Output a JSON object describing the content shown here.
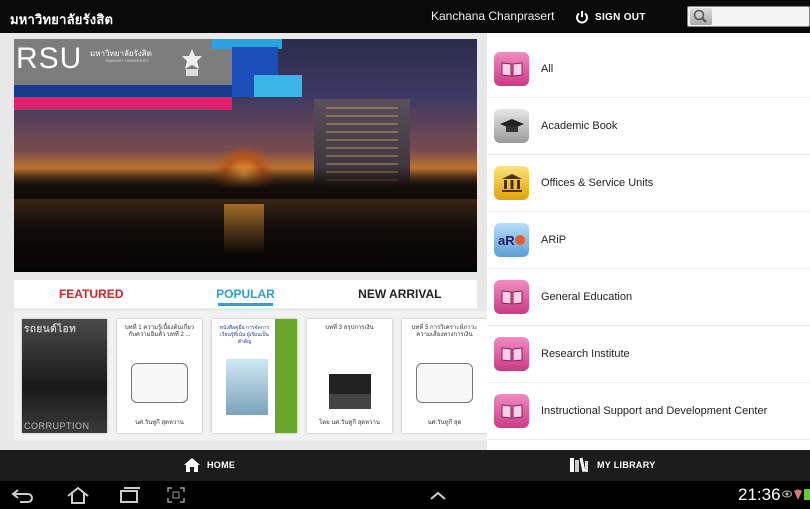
{
  "topbar": {
    "app_title": "มหาวิทยาลัยรังสิต",
    "user_name": "Kanchana Chanprasert",
    "signout_label": "SIGN OUT",
    "search_value": ""
  },
  "hero": {
    "logo_text": "RSU",
    "logo_subtitle_th": "มหาวิทยาลัยรังสิต",
    "logo_subtitle_en": "RANGSIT UNIVERSITY"
  },
  "tabs": [
    {
      "label": "FEATURED"
    },
    {
      "label": "POPULAR"
    },
    {
      "label": "NEW ARRIVAL"
    }
  ],
  "active_tab": "POPULAR",
  "books": [
    {
      "top_text": "รถยนต์ไอท",
      "bottom_text": "CORRUPTION"
    },
    {
      "title": "บทที่ 1 ความรู้เบื้องต้นเกี่ยวกับความอิ่มตัว บทที่ 2 ...",
      "author": "นศ.วันทูกี สุดหวาน"
    },
    {
      "title": "หนังสือคู่มือ การจัดการเรียนรู้ที่เน้น ผู้เรียนเป็นสำคัญ"
    },
    {
      "title": "บทที่ 3 สรุปการเงิน",
      "author": "โดย นศ.วันทูกี สุดหวาน"
    },
    {
      "title": "บทที่ 5 การวิเคราะห์ภาวะ ความเสี่ยงทางการเงิน",
      "author": "นศ.วันทูกี สุด"
    }
  ],
  "categories": [
    {
      "label": "All",
      "icon": "book-icon",
      "color": "#d84a93"
    },
    {
      "label": "Academic Book",
      "icon": "graduation-cap-icon",
      "color": "#9a9a9a"
    },
    {
      "label": "Offices & Service Units",
      "icon": "institution-icon",
      "color": "#e0a10a"
    },
    {
      "label": "ARiP",
      "icon": "arip-logo-icon",
      "color": "#5a9fd7"
    },
    {
      "label": "General Education",
      "icon": "book-icon",
      "color": "#d84a93"
    },
    {
      "label": "Research Institute",
      "icon": "book-icon",
      "color": "#d84a93"
    },
    {
      "label": "Instructional Support and Development Center",
      "icon": "book-icon",
      "color": "#d84a93"
    }
  ],
  "bottomnav": {
    "home_label": "HOME",
    "library_label": "MY LIBRARY"
  },
  "system": {
    "clock": "21:36"
  },
  "colors": {
    "featured": "#d2232a",
    "popular": "#2a9fd8",
    "topbar": "#0a0a0a"
  }
}
